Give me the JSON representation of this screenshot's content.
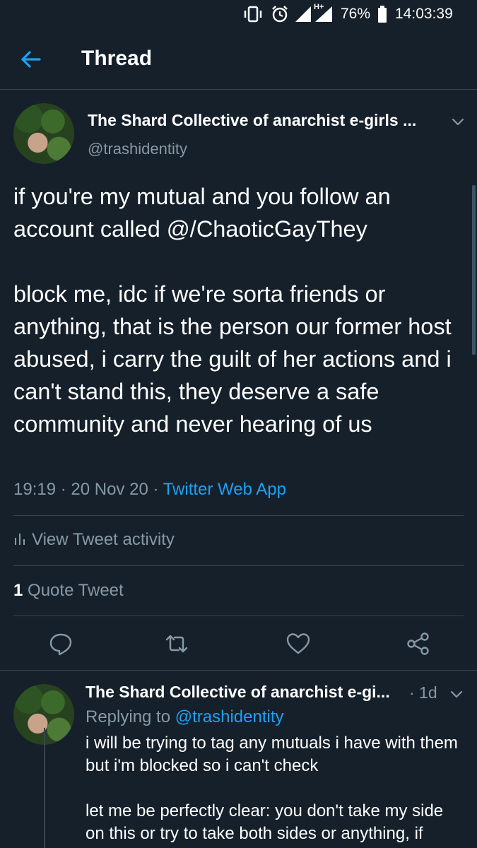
{
  "status_bar": {
    "battery": "76%",
    "time": "14:03:39",
    "network": "H+",
    "icons": [
      "vibrate-icon",
      "alarm-icon",
      "signal-icon",
      "battery-icon"
    ]
  },
  "header": {
    "title": "Thread",
    "back_icon": "back-arrow-icon"
  },
  "tweet": {
    "display_name": "The Shard Collective of anarchist e-girls ...",
    "handle": "@trashidentity",
    "text_paragraph_1": "if you're my mutual and you follow  an account called @/ChaoticGayThey",
    "text_paragraph_2": "block me, idc if we're sorta friends or anything, that is the person our former host abused, i carry the guilt of her actions and i can't stand this, they deserve a safe community and never hearing of us",
    "timestamp": "19:19 · 20 Nov 20 · ",
    "source": "Twitter Web App",
    "activity_label": "View Tweet activity",
    "quote_count": "1",
    "quote_label": "Quote Tweet"
  },
  "reply": {
    "display_name": "The Shard Collective of anarchist e-gi...",
    "age": "· 1d",
    "replying_prefix": "Replying to ",
    "replying_handle": "@trashidentity",
    "text_paragraph_1": "i will be trying to tag any mutuals i have with them but i'm blocked so i can't check",
    "text_paragraph_2": "let me be perfectly clear: you don't take my side on this or try to take both sides or anything, if"
  },
  "colors": {
    "background": "#15202b",
    "accent": "#1da1f2",
    "secondary_text": "#8899a6",
    "divider": "#38444d"
  }
}
